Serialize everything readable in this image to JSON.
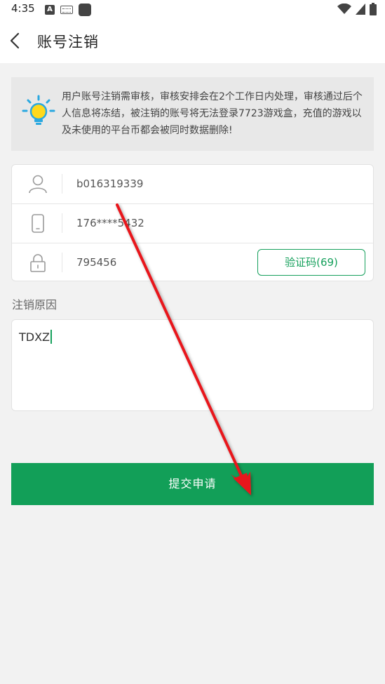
{
  "status_bar": {
    "time": "4:35",
    "left_icons": [
      "a-icon",
      "keyboard-icon",
      "square-icon"
    ],
    "right_icons": [
      "wifi-icon",
      "signal-icon",
      "battery-icon"
    ]
  },
  "header": {
    "title": "账号注销",
    "back_icon": "chevron-left-icon"
  },
  "notice": {
    "icon": "lightbulb-icon",
    "text": "用户账号注销需审核，审核安排会在2个工作日内处理，审核通过后个人信息将冻结，被注销的账号将无法登录7723游戏盒，充值的游戏以及未使用的平台币都会被同时数据删除!"
  },
  "form": {
    "account": {
      "icon": "user-icon",
      "value": "b016319339"
    },
    "phone": {
      "icon": "phone-icon",
      "value": "176****5432"
    },
    "code": {
      "icon": "lock-icon",
      "value": "795456",
      "button_label": "验证码(69)"
    }
  },
  "reason": {
    "label": "注销原因",
    "value": "TDXZ"
  },
  "submit": {
    "label": "提交申请"
  },
  "colors": {
    "accent": "#129f58",
    "background": "#f2f2f2",
    "notice_bg": "#e8e8e8",
    "annotation_arrow": "#e8161b"
  }
}
